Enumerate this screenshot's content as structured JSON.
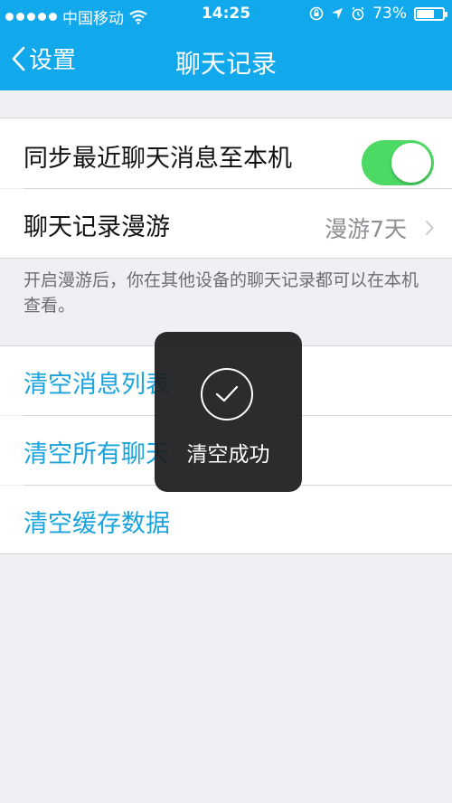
{
  "status_bar": {
    "carrier": "中国移动",
    "time": "14:25",
    "battery_percent": "73%",
    "battery_level": 0.73,
    "icons": [
      "signal-dots",
      "wifi-icon",
      "lock-rotation-icon",
      "location-icon",
      "alarm-icon",
      "battery-icon"
    ]
  },
  "nav": {
    "back_label": "设置",
    "title": "聊天记录"
  },
  "settings": {
    "sync_label": "同步最近聊天消息至本机",
    "sync_enabled": true,
    "roaming_label": "聊天记录漫游",
    "roaming_value": "漫游7天",
    "roaming_note": "开启漫游后，你在其他设备的聊天记录都可以在本机查看。"
  },
  "actions": {
    "clear_list": "清空消息列表",
    "clear_all_prefix": "清空所有聊天",
    "clear_all_suffix": "",
    "clear_cache": "清空缓存数据"
  },
  "toast": {
    "message": "清空成功",
    "icon": "checkmark-icon"
  },
  "colors": {
    "nav_blue": "#12a9ec",
    "toggle_green": "#4cd964",
    "action_blue": "#1aa3dc"
  }
}
